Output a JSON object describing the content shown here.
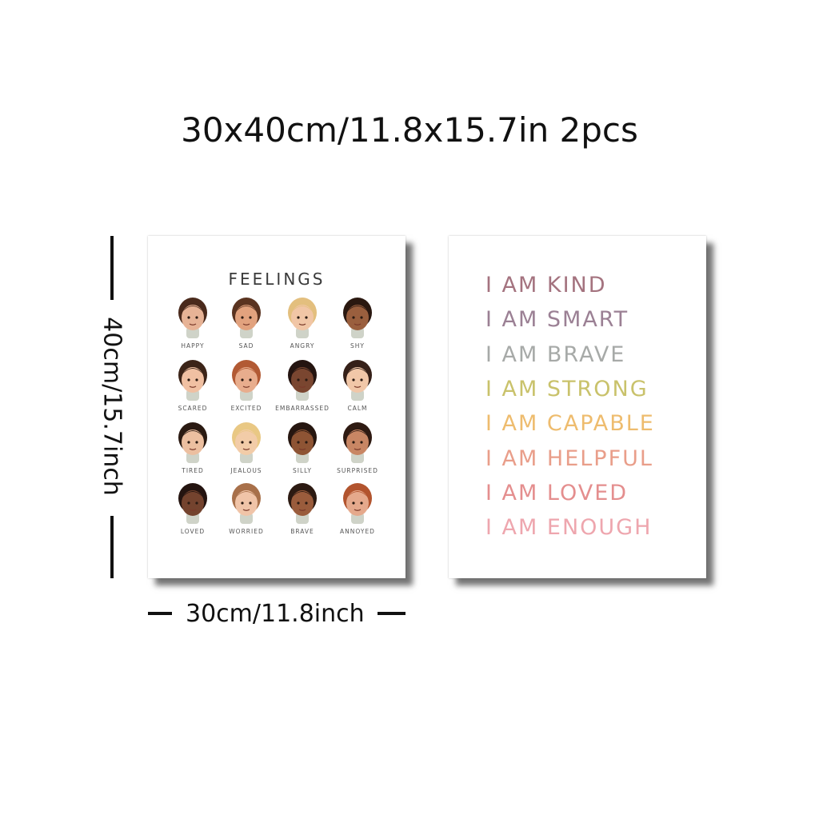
{
  "headline": "30x40cm/11.8x15.7in 2pcs",
  "dimensions": {
    "height_label": "40cm/15.7inch",
    "width_label": "30cm/11.8inch"
  },
  "feelings_poster": {
    "title": "FEELINGS",
    "faces": [
      {
        "label": "HAPPY",
        "skin": "#e7b396",
        "hair": "#4a2a1c"
      },
      {
        "label": "SAD",
        "skin": "#e2a27e",
        "hair": "#5a3320"
      },
      {
        "label": "ANGRY",
        "skin": "#f1c6a6",
        "hair": "#e3bf7e"
      },
      {
        "label": "SHY",
        "skin": "#9a5f3e",
        "hair": "#2a1810"
      },
      {
        "label": "SCARED",
        "skin": "#f0c0a2",
        "hair": "#3c2418"
      },
      {
        "label": "EXCITED",
        "skin": "#e8ad8d",
        "hair": "#b25a34"
      },
      {
        "label": "EMBARRASSED",
        "skin": "#7a4630",
        "hair": "#241410"
      },
      {
        "label": "CALM",
        "skin": "#f1c7a8",
        "hair": "#352018"
      },
      {
        "label": "TIRED",
        "skin": "#ecbfa0",
        "hair": "#2a1a12"
      },
      {
        "label": "JEALOUS",
        "skin": "#f2cca8",
        "hair": "#e9c884"
      },
      {
        "label": "SILLY",
        "skin": "#8e5434",
        "hair": "#261610"
      },
      {
        "label": "SURPRISED",
        "skin": "#c88664",
        "hair": "#2e1a12"
      },
      {
        "label": "LOVED",
        "skin": "#74432e",
        "hair": "#241410"
      },
      {
        "label": "WORRIED",
        "skin": "#f0c4a8",
        "hair": "#a8704a"
      },
      {
        "label": "BRAVE",
        "skin": "#9a5c3c",
        "hair": "#2c1a12"
      },
      {
        "label": "ANNOYED",
        "skin": "#e5a98c",
        "hair": "#b2542e"
      }
    ]
  },
  "affirmations_poster": {
    "lines": [
      {
        "text": "I AM KIND",
        "color": "#a4737f"
      },
      {
        "text": "I AM SMART",
        "color": "#9b8094"
      },
      {
        "text": "I AM BRAVE",
        "color": "#a7aaa8"
      },
      {
        "text": "I AM STRONG",
        "color": "#c9c26b"
      },
      {
        "text": "I AM CAPABLE",
        "color": "#eebc6e"
      },
      {
        "text": "I AM HELPFUL",
        "color": "#e99e8a"
      },
      {
        "text": "I AM LOVED",
        "color": "#e48e8e"
      },
      {
        "text": "I AM ENOUGH",
        "color": "#eea6ae"
      }
    ]
  }
}
